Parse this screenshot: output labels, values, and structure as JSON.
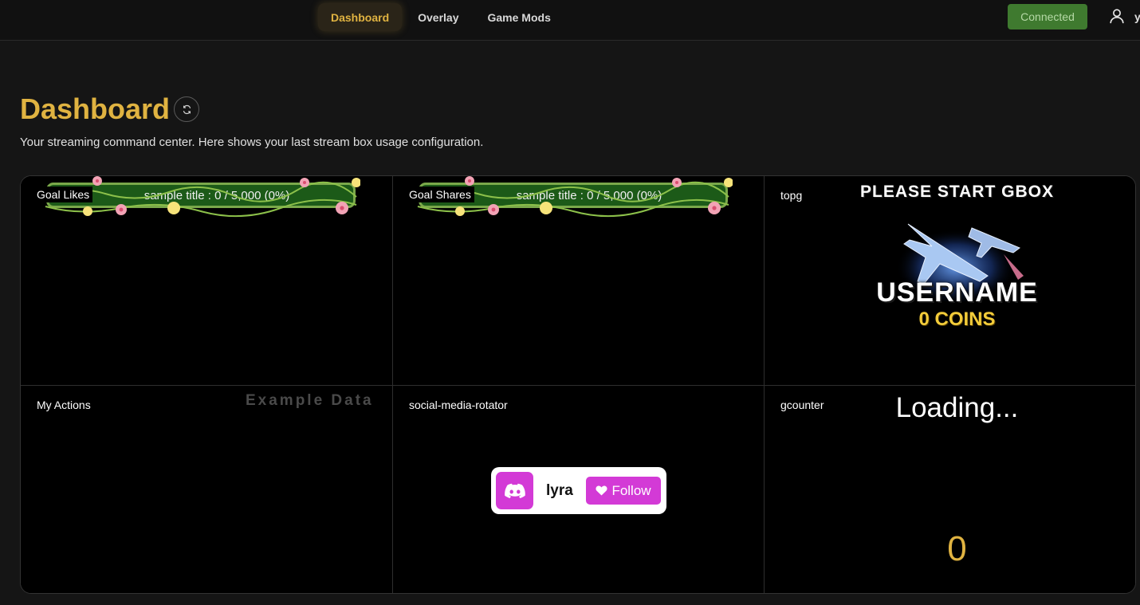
{
  "nav": {
    "tabs": [
      {
        "label": "Dashboard",
        "active": true
      },
      {
        "label": "Overlay",
        "active": false
      },
      {
        "label": "Game Mods",
        "active": false
      }
    ],
    "status_label": "Connected",
    "user_initial": "y",
    "accent_color": "#e0b341",
    "status_color": "#3f7a2f"
  },
  "header": {
    "title": "Dashboard",
    "subtitle": "Your streaming command center. Here shows your last stream box usage configuration.",
    "refresh_icon": "refresh-icon"
  },
  "widgets": {
    "goal_likes": {
      "label": "Goal Likes",
      "bar_text": "sample title : 0 / 5,000 (0%)",
      "progress": 0
    },
    "goal_shares": {
      "label": "Goal Shares",
      "bar_text": "sample title : 0 / 5,000 (0%)",
      "progress": 0
    },
    "topg": {
      "label": "topg",
      "status": "PLEASE START GBOX",
      "username": "USERNAME",
      "coins": "0 COINS"
    },
    "my_actions": {
      "label": "My Actions",
      "watermark": "Example Data"
    },
    "social": {
      "label": "social-media-rotator",
      "name": "lyra",
      "follow_label": "Follow",
      "platform_icon": "discord-icon",
      "brand_color": "#d33ad6"
    },
    "gcounter": {
      "label": "gcounter",
      "loading": "Loading...",
      "value": "0"
    }
  }
}
